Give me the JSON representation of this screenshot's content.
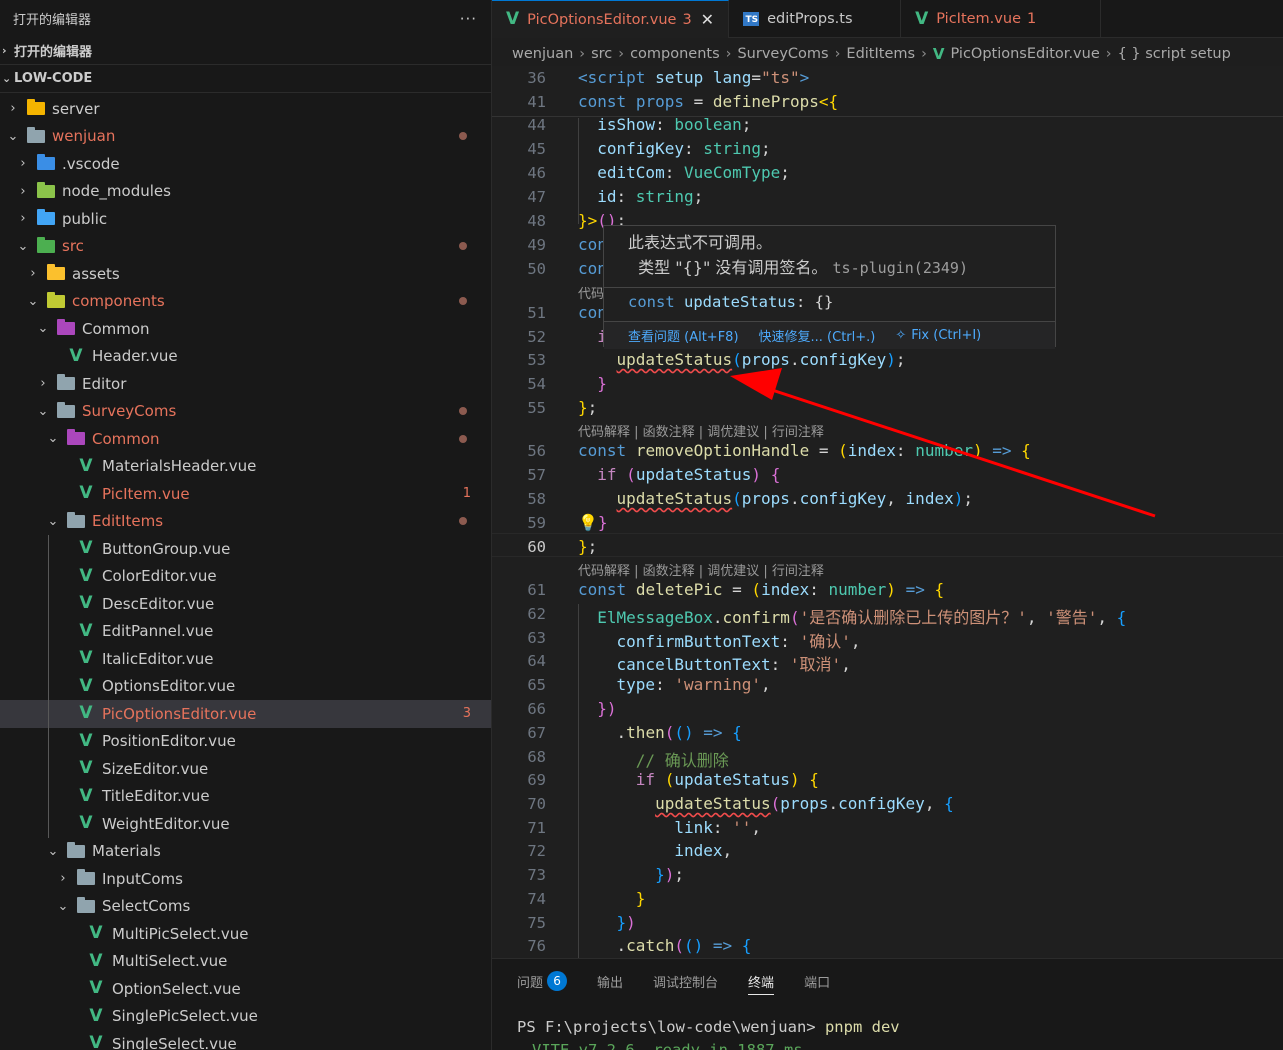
{
  "sidebar": {
    "title": "打开的编辑器",
    "more": "···",
    "open_editors_section": "打开的编辑器",
    "project_section": "LOW-CODE",
    "tree": [
      {
        "label": "server",
        "depth": 0,
        "chev": "›",
        "icon": "folder-server"
      },
      {
        "label": "wenjuan",
        "depth": 0,
        "chev": "⌄",
        "icon": "folder-open",
        "modified": true,
        "dot": true
      },
      {
        "label": ".vscode",
        "depth": 1,
        "chev": "›",
        "icon": "folder-vscode"
      },
      {
        "label": "node_modules",
        "depth": 1,
        "chev": "›",
        "icon": "folder-node"
      },
      {
        "label": "public",
        "depth": 1,
        "chev": "›",
        "icon": "folder-public"
      },
      {
        "label": "src",
        "depth": 1,
        "chev": "⌄",
        "icon": "folder-src",
        "modified": true,
        "dot": true
      },
      {
        "label": "assets",
        "depth": 2,
        "chev": "›",
        "icon": "folder-assets"
      },
      {
        "label": "components",
        "depth": 2,
        "chev": "⌄",
        "icon": "folder-components",
        "modified": true,
        "dot": true
      },
      {
        "label": "Common",
        "depth": 3,
        "chev": "⌄",
        "icon": "folder-common"
      },
      {
        "label": "Header.vue",
        "depth": 4,
        "chev": "",
        "icon": "vue"
      },
      {
        "label": "Editor",
        "depth": 3,
        "chev": "›",
        "icon": "folder"
      },
      {
        "label": "SurveyComs",
        "depth": 3,
        "chev": "⌄",
        "icon": "folder-open",
        "modified": true,
        "dot": true
      },
      {
        "label": "Common",
        "depth": 4,
        "chev": "⌄",
        "icon": "folder-common",
        "modified": true,
        "dot": true
      },
      {
        "label": "MaterialsHeader.vue",
        "depth": 5,
        "chev": "",
        "icon": "vue"
      },
      {
        "label": "PicItem.vue",
        "depth": 5,
        "chev": "",
        "icon": "vue",
        "modified": true,
        "badge": "1"
      },
      {
        "label": "EditItems",
        "depth": 4,
        "chev": "⌄",
        "icon": "folder-open",
        "modified": true,
        "dot": true
      },
      {
        "label": "ButtonGroup.vue",
        "depth": 5,
        "chev": "",
        "icon": "vue"
      },
      {
        "label": "ColorEditor.vue",
        "depth": 5,
        "chev": "",
        "icon": "vue"
      },
      {
        "label": "DescEditor.vue",
        "depth": 5,
        "chev": "",
        "icon": "vue"
      },
      {
        "label": "EditPannel.vue",
        "depth": 5,
        "chev": "",
        "icon": "vue"
      },
      {
        "label": "ItalicEditor.vue",
        "depth": 5,
        "chev": "",
        "icon": "vue"
      },
      {
        "label": "OptionsEditor.vue",
        "depth": 5,
        "chev": "",
        "icon": "vue"
      },
      {
        "label": "PicOptionsEditor.vue",
        "depth": 5,
        "chev": "",
        "icon": "vue",
        "modified": true,
        "badge": "3",
        "selected": true
      },
      {
        "label": "PositionEditor.vue",
        "depth": 5,
        "chev": "",
        "icon": "vue"
      },
      {
        "label": "SizeEditor.vue",
        "depth": 5,
        "chev": "",
        "icon": "vue"
      },
      {
        "label": "TitleEditor.vue",
        "depth": 5,
        "chev": "",
        "icon": "vue"
      },
      {
        "label": "WeightEditor.vue",
        "depth": 5,
        "chev": "",
        "icon": "vue"
      },
      {
        "label": "Materials",
        "depth": 4,
        "chev": "⌄",
        "icon": "folder-open"
      },
      {
        "label": "InputComs",
        "depth": 5,
        "chev": "›",
        "icon": "folder"
      },
      {
        "label": "SelectComs",
        "depth": 5,
        "chev": "⌄",
        "icon": "folder-open"
      },
      {
        "label": "MultiPicSelect.vue",
        "depth": 6,
        "chev": "",
        "icon": "vue"
      },
      {
        "label": "MultiSelect.vue",
        "depth": 6,
        "chev": "",
        "icon": "vue"
      },
      {
        "label": "OptionSelect.vue",
        "depth": 6,
        "chev": "",
        "icon": "vue"
      },
      {
        "label": "SinglePicSelect.vue",
        "depth": 6,
        "chev": "",
        "icon": "vue"
      },
      {
        "label": "SingleSelect.vue",
        "depth": 6,
        "chev": "",
        "icon": "vue"
      }
    ]
  },
  "tabs": [
    {
      "label": "PicOptionsEditor.vue",
      "badge": "3",
      "close": "✕",
      "active": true,
      "icon": "vue"
    },
    {
      "label": "editProps.ts",
      "icon": "ts"
    },
    {
      "label": "PicItem.vue",
      "badge": "1",
      "icon": "vue"
    }
  ],
  "breadcrumb": [
    "wenjuan",
    "src",
    "components",
    "SurveyComs",
    "EditItems",
    "PicOptionsEditor.vue",
    "{ } script setup"
  ],
  "editor": {
    "line_numbers": [
      "36",
      "41",
      "44",
      "45",
      "46",
      "47",
      "48",
      "49",
      "50",
      "51",
      "52",
      "53",
      "54",
      "55",
      "56",
      "57",
      "58",
      "59",
      "60",
      "61",
      "62",
      "63",
      "64",
      "65",
      "66",
      "67",
      "68",
      "69",
      "70",
      "71",
      "72",
      "73",
      "74",
      "75",
      "76"
    ],
    "code_lens": "代码解释 | 函数注释 | 调优建议 | 行间注释",
    "code_lens_truncated": "代码解"
  },
  "hover": {
    "line1": "此表达式不可调用。",
    "line2": "  类型 \"{}\" 没有调用签名。",
    "source": "ts-plugin(2349)",
    "signature_kw": "const",
    "signature_name": "updateStatus",
    "signature_type": ": {}",
    "action_view": "查看问题 (Alt+F8)",
    "action_quickfix": "快速修复... (Ctrl+.)",
    "action_fix": "Fix (Ctrl+I)"
  },
  "panel": {
    "tabs": [
      "问题",
      "输出",
      "调试控制台",
      "终端",
      "端口"
    ],
    "problems_count": "6",
    "active_tab": "终端",
    "prompt": "PS F:\\projects\\low-code\\wenjuan> ",
    "command": "pnpm dev",
    "output_partial": "VITE v7.2.6  ready in 1887 ms"
  },
  "colors": {
    "accent": "#0078d4",
    "error": "#f14c4c",
    "modified": "#e6735c",
    "vue": "#42b883",
    "arrow": "#ff0000"
  }
}
